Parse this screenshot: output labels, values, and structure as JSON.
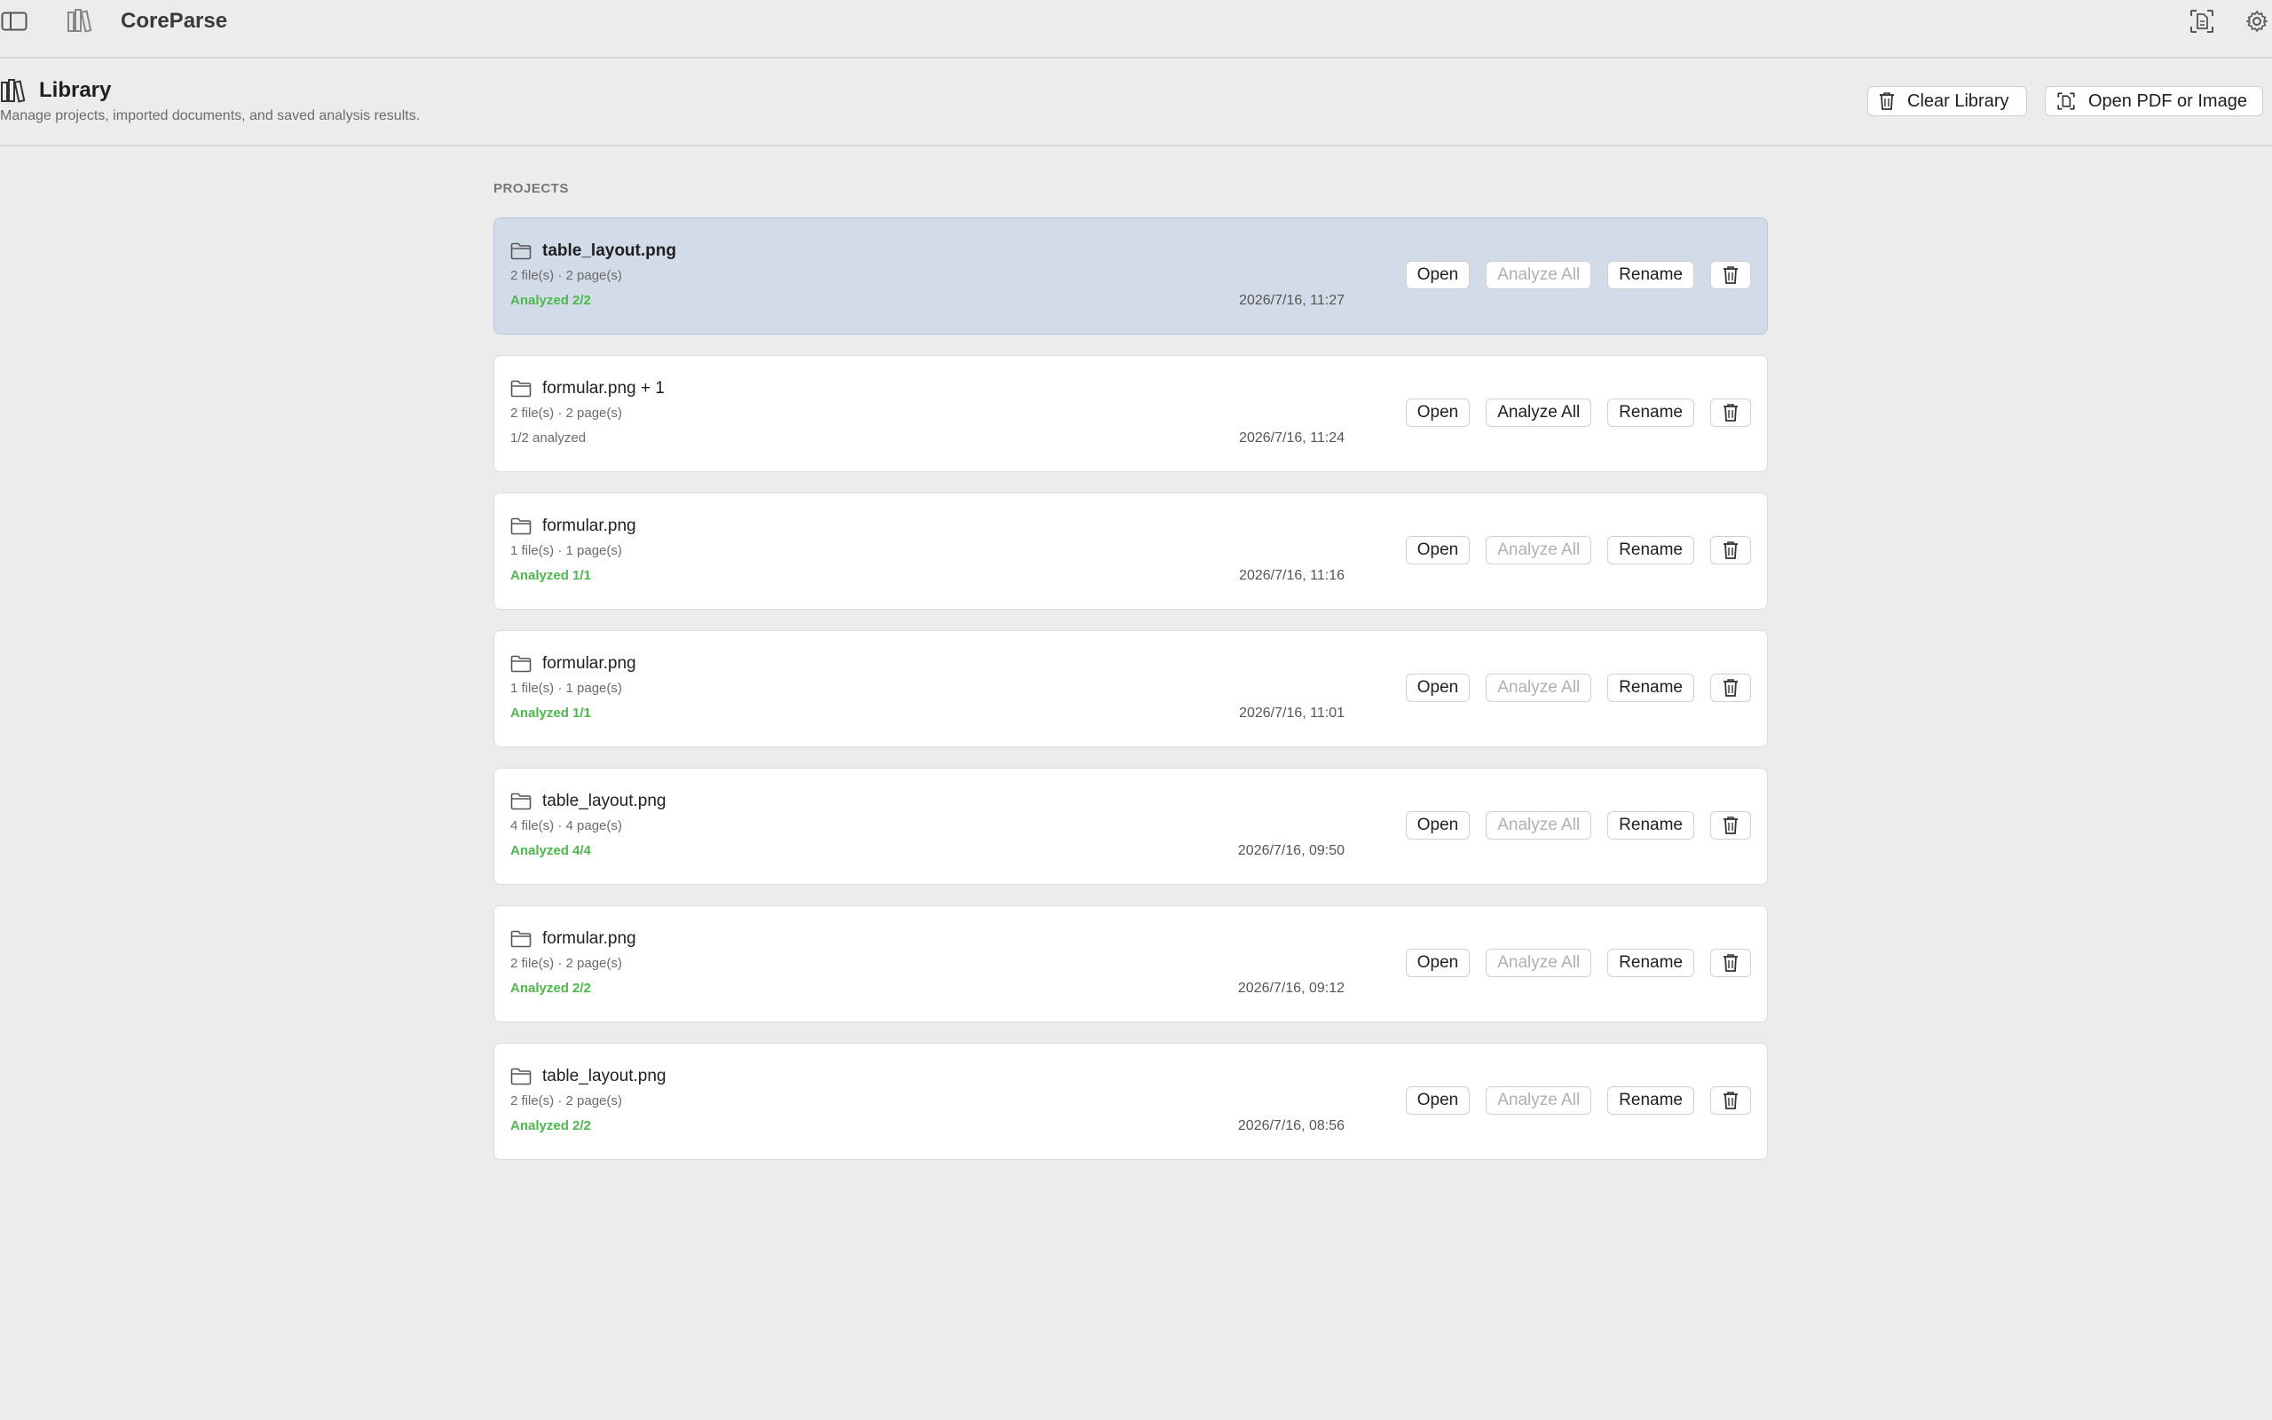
{
  "app": {
    "title": "CoreParse"
  },
  "titlebar": {
    "sidebar_toggle_icon": "sidebar-toggle-icon",
    "library_icon": "library-books-icon",
    "scan_icon": "document-scan-icon",
    "settings_icon": "gear-icon"
  },
  "header": {
    "title": "Library",
    "subtitle": "Manage projects, imported documents, and saved analysis results.",
    "clear_label": "Clear Library",
    "open_label": "Open PDF or Image"
  },
  "projects": {
    "section_label": "PROJECTS",
    "status_color": "#4cb84c",
    "selected_color": "#d2dbe8",
    "items": [
      {
        "name": "table_layout.png",
        "meta": "2 file(s) · 2 page(s)",
        "status": "Analyzed 2/2",
        "date": "2026/7/16, 11:27",
        "selected": true,
        "analyze_enabled": false
      },
      {
        "name": "formular.png + 1",
        "meta": "2 file(s) · 2 page(s)",
        "status": "1/2 analyzed",
        "date": "2026/7/16, 11:24",
        "selected": false,
        "analyze_enabled": true
      },
      {
        "name": "formular.png",
        "meta": "1 file(s) · 1 page(s)",
        "status": "Analyzed 1/1",
        "date": "2026/7/16, 11:16",
        "selected": false,
        "analyze_enabled": false
      },
      {
        "name": "formular.png",
        "meta": "1 file(s) · 1 page(s)",
        "status": "Analyzed 1/1",
        "date": "2026/7/16, 11:01",
        "selected": false,
        "analyze_enabled": false
      },
      {
        "name": "table_layout.png",
        "meta": "4 file(s) · 4 page(s)",
        "status": "Analyzed 4/4",
        "date": "2026/7/16, 09:50",
        "selected": false,
        "analyze_enabled": false
      },
      {
        "name": "formular.png",
        "meta": "2 file(s) · 2 page(s)",
        "status": "Analyzed 2/2",
        "date": "2026/7/16, 09:12",
        "selected": false,
        "analyze_enabled": false
      },
      {
        "name": "table_layout.png",
        "meta": "2 file(s) · 2 page(s)",
        "status": "Analyzed 2/2",
        "date": "2026/7/16, 08:56",
        "selected": false,
        "analyze_enabled": false
      }
    ],
    "actions": {
      "open_label": "Open",
      "analyze_label": "Analyze All",
      "rename_label": "Rename",
      "delete_icon": "trash-icon"
    }
  }
}
